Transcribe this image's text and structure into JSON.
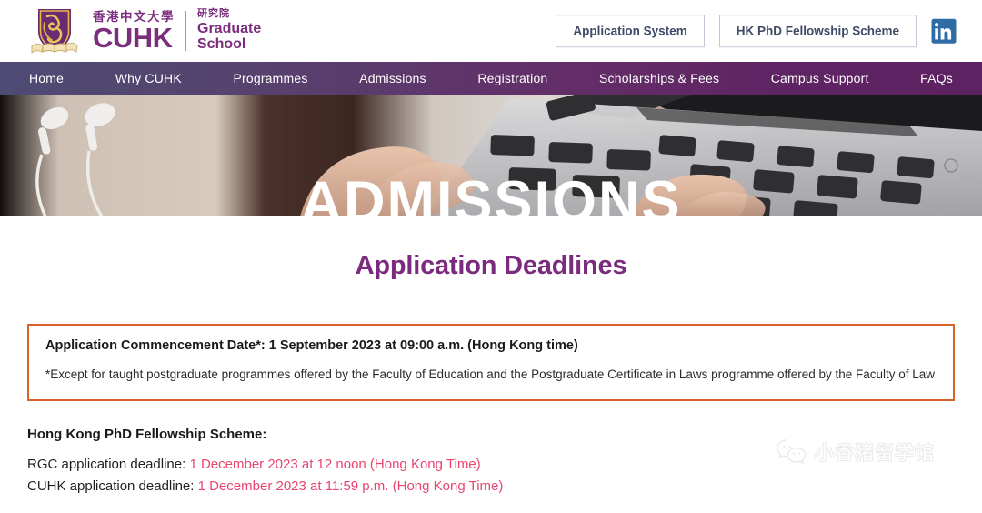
{
  "header": {
    "logo": {
      "crest_icon": "cuhk-crest-icon",
      "chinese_name": "香港中文大學",
      "english_name": "CUHK",
      "unit_chinese": "研究院",
      "unit_english_line1": "Graduate",
      "unit_english_line2": "School"
    },
    "buttons": [
      {
        "label": "Application System",
        "name": "application-system-button"
      },
      {
        "label": "HK PhD Fellowship Scheme",
        "name": "hk-phd-fellowship-scheme-button"
      }
    ],
    "social": {
      "icon": "linkedin-icon",
      "label": "in"
    }
  },
  "nav": {
    "items": [
      "Home",
      "Why CUHK",
      "Programmes",
      "Admissions",
      "Registration",
      "Scholarships & Fees",
      "Campus Support",
      "FAQs"
    ]
  },
  "hero": {
    "title": "ADMISSIONS",
    "image_description": "hands-typing-on-laptop-keyboard-with-earbuds"
  },
  "main": {
    "page_title": "Application Deadlines",
    "notice": {
      "heading": "Application Commencement Date*: 1 September 2023 at 09:00 a.m. (Hong Kong time)",
      "body": "*Except for taught postgraduate programmes offered by the Faculty of Education and the Postgraduate Certificate in Laws programme offered by the Faculty of Law"
    },
    "fellowship": {
      "heading": "Hong Kong PhD Fellowship Scheme:",
      "rows": [
        {
          "label": "RGC application deadline: ",
          "value": "1 December 2023 at 12 noon (Hong Kong Time)"
        },
        {
          "label": "CUHK application deadline: ",
          "value": "1 December 2023 at 11:59 p.m. (Hong Kong Time)"
        }
      ]
    }
  },
  "watermark": {
    "text": "小香猪留学馆",
    "icon": "wechat-icon"
  },
  "colors": {
    "brand_purple": "#7b2d7e",
    "nav_gradient_start": "#4e4b74",
    "nav_gradient_end": "#5d2262",
    "notice_border_orange": "#d9622b",
    "deadline_pink": "#e8456f",
    "button_text": "#3e4a66",
    "linkedin_blue": "#2f6ca5"
  }
}
